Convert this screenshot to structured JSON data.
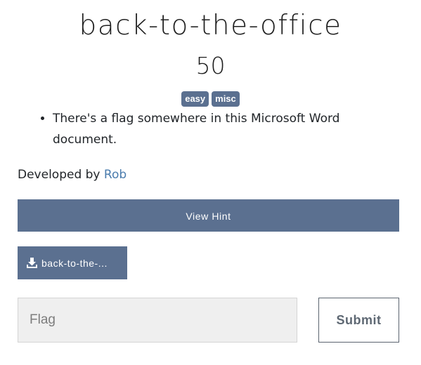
{
  "challenge": {
    "title": "back-to-the-office",
    "points": "50",
    "tags": [
      "easy",
      "misc"
    ],
    "description": "There's a flag somewhere in this Microsoft Word document.",
    "developed_by_prefix": "Developed by ",
    "author": "Rob"
  },
  "actions": {
    "view_hint_label": "View Hint",
    "file_label": "back-to-the-...",
    "file_icon": "download-icon"
  },
  "flag_form": {
    "placeholder": "Flag",
    "value": "",
    "submit_label": "Submit"
  },
  "colors": {
    "accent": "#5b7090",
    "link": "#4a7cad",
    "input_bg": "#efefef"
  }
}
